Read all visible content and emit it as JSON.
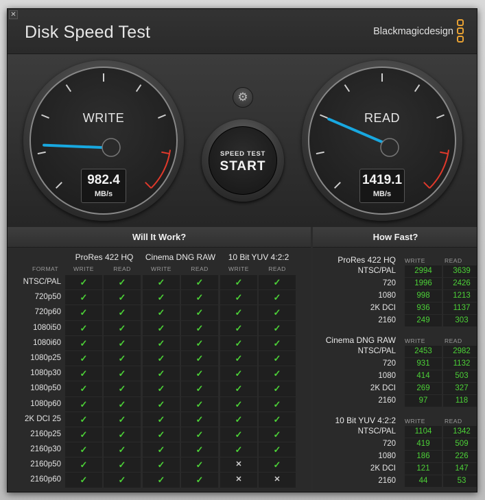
{
  "window": {
    "title": "Disk Speed Test",
    "brand": "Blackmagicdesign",
    "close_glyph": "✕"
  },
  "gauges": {
    "write": {
      "label": "WRITE",
      "value": "982.4",
      "unit": "MB/s"
    },
    "read": {
      "label": "READ",
      "value": "1419.1",
      "unit": "MB/s"
    }
  },
  "controls": {
    "settings_icon": "gear-icon",
    "start_small": "SPEED TEST",
    "start_big": "START"
  },
  "will_it_work": {
    "title": "Will It Work?",
    "format_header": "FORMAT",
    "write_header": "WRITE",
    "read_header": "READ",
    "groups": [
      "ProRes 422 HQ",
      "Cinema DNG RAW",
      "10 Bit YUV 4:2:2"
    ],
    "rows": [
      {
        "format": "NTSC/PAL",
        "cells": [
          1,
          1,
          1,
          1,
          1,
          1
        ]
      },
      {
        "format": "720p50",
        "cells": [
          1,
          1,
          1,
          1,
          1,
          1
        ]
      },
      {
        "format": "720p60",
        "cells": [
          1,
          1,
          1,
          1,
          1,
          1
        ]
      },
      {
        "format": "1080i50",
        "cells": [
          1,
          1,
          1,
          1,
          1,
          1
        ]
      },
      {
        "format": "1080i60",
        "cells": [
          1,
          1,
          1,
          1,
          1,
          1
        ]
      },
      {
        "format": "1080p25",
        "cells": [
          1,
          1,
          1,
          1,
          1,
          1
        ]
      },
      {
        "format": "1080p30",
        "cells": [
          1,
          1,
          1,
          1,
          1,
          1
        ]
      },
      {
        "format": "1080p50",
        "cells": [
          1,
          1,
          1,
          1,
          1,
          1
        ]
      },
      {
        "format": "1080p60",
        "cells": [
          1,
          1,
          1,
          1,
          1,
          1
        ]
      },
      {
        "format": "2K DCI 25",
        "cells": [
          1,
          1,
          1,
          1,
          1,
          1
        ]
      },
      {
        "format": "2160p25",
        "cells": [
          1,
          1,
          1,
          1,
          1,
          1
        ]
      },
      {
        "format": "2160p30",
        "cells": [
          1,
          1,
          1,
          1,
          1,
          1
        ]
      },
      {
        "format": "2160p50",
        "cells": [
          1,
          1,
          1,
          1,
          0,
          1
        ]
      },
      {
        "format": "2160p60",
        "cells": [
          1,
          1,
          1,
          1,
          0,
          0
        ]
      }
    ]
  },
  "how_fast": {
    "title": "How Fast?",
    "write_header": "WRITE",
    "read_header": "READ",
    "groups": [
      {
        "name": "ProRes 422 HQ",
        "rows": [
          {
            "format": "NTSC/PAL",
            "write": "2994",
            "read": "3639"
          },
          {
            "format": "720",
            "write": "1996",
            "read": "2426"
          },
          {
            "format": "1080",
            "write": "998",
            "read": "1213"
          },
          {
            "format": "2K DCI",
            "write": "936",
            "read": "1137"
          },
          {
            "format": "2160",
            "write": "249",
            "read": "303"
          }
        ]
      },
      {
        "name": "Cinema DNG RAW",
        "rows": [
          {
            "format": "NTSC/PAL",
            "write": "2453",
            "read": "2982"
          },
          {
            "format": "720",
            "write": "931",
            "read": "1132"
          },
          {
            "format": "1080",
            "write": "414",
            "read": "503"
          },
          {
            "format": "2K DCI",
            "write": "269",
            "read": "327"
          },
          {
            "format": "2160",
            "write": "97",
            "read": "118"
          }
        ]
      },
      {
        "name": "10 Bit YUV 4:2:2",
        "rows": [
          {
            "format": "NTSC/PAL",
            "write": "1104",
            "read": "1342"
          },
          {
            "format": "720",
            "write": "419",
            "read": "509"
          },
          {
            "format": "1080",
            "write": "186",
            "read": "226"
          },
          {
            "format": "2K DCI",
            "write": "121",
            "read": "147"
          },
          {
            "format": "2160",
            "write": "44",
            "read": "53"
          }
        ]
      }
    ]
  },
  "glyphs": {
    "check": "✓",
    "cross": "✕"
  },
  "colors": {
    "ok": "#4cd137",
    "needle": "#18a8e0",
    "redline": "#e0392b",
    "brand_accent": "#e8a133"
  }
}
